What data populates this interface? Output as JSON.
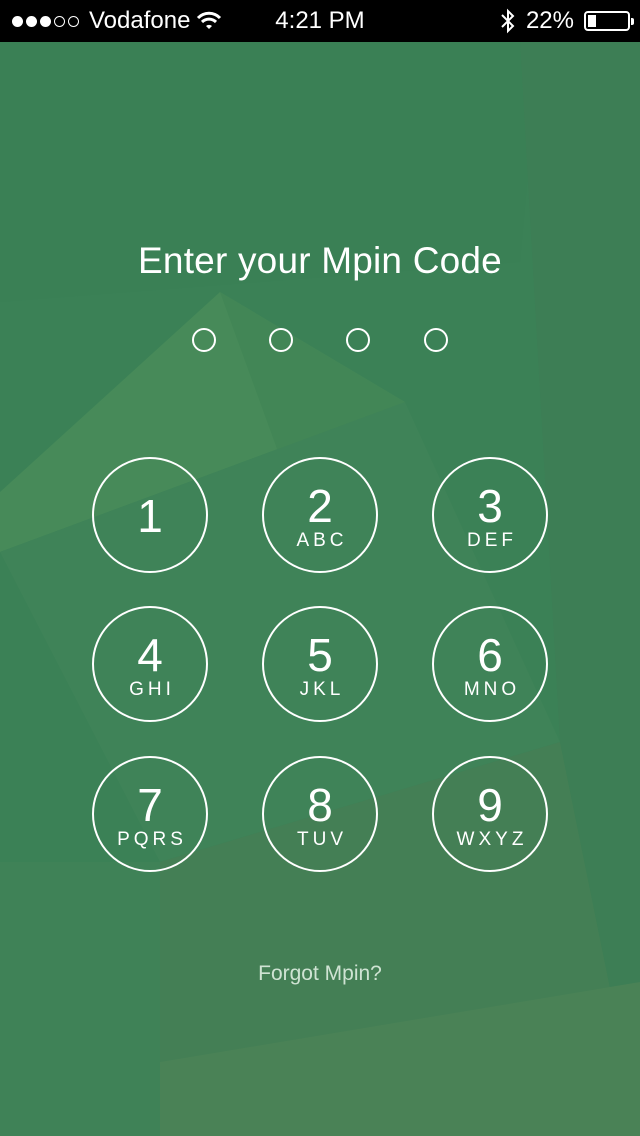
{
  "status_bar": {
    "carrier": "Vodafone",
    "time": "4:21 PM",
    "battery_percent": "22%",
    "battery_level": 0.22,
    "signal_bars": 3,
    "signal_total": 5
  },
  "title": "Enter your Mpin Code",
  "pin_length": 4,
  "keypad": [
    {
      "digit": "1",
      "letters": ""
    },
    {
      "digit": "2",
      "letters": "ABC"
    },
    {
      "digit": "3",
      "letters": "DEF"
    },
    {
      "digit": "4",
      "letters": "GHI"
    },
    {
      "digit": "5",
      "letters": "JKL"
    },
    {
      "digit": "6",
      "letters": "MNO"
    },
    {
      "digit": "7",
      "letters": "PQRS"
    },
    {
      "digit": "8",
      "letters": "TUV"
    },
    {
      "digit": "9",
      "letters": "WXYZ"
    }
  ],
  "forgot_link": "Forgot Mpin?",
  "colors": {
    "background": "#3d8257",
    "status_bar": "#000000",
    "accent": "#ffffff"
  }
}
